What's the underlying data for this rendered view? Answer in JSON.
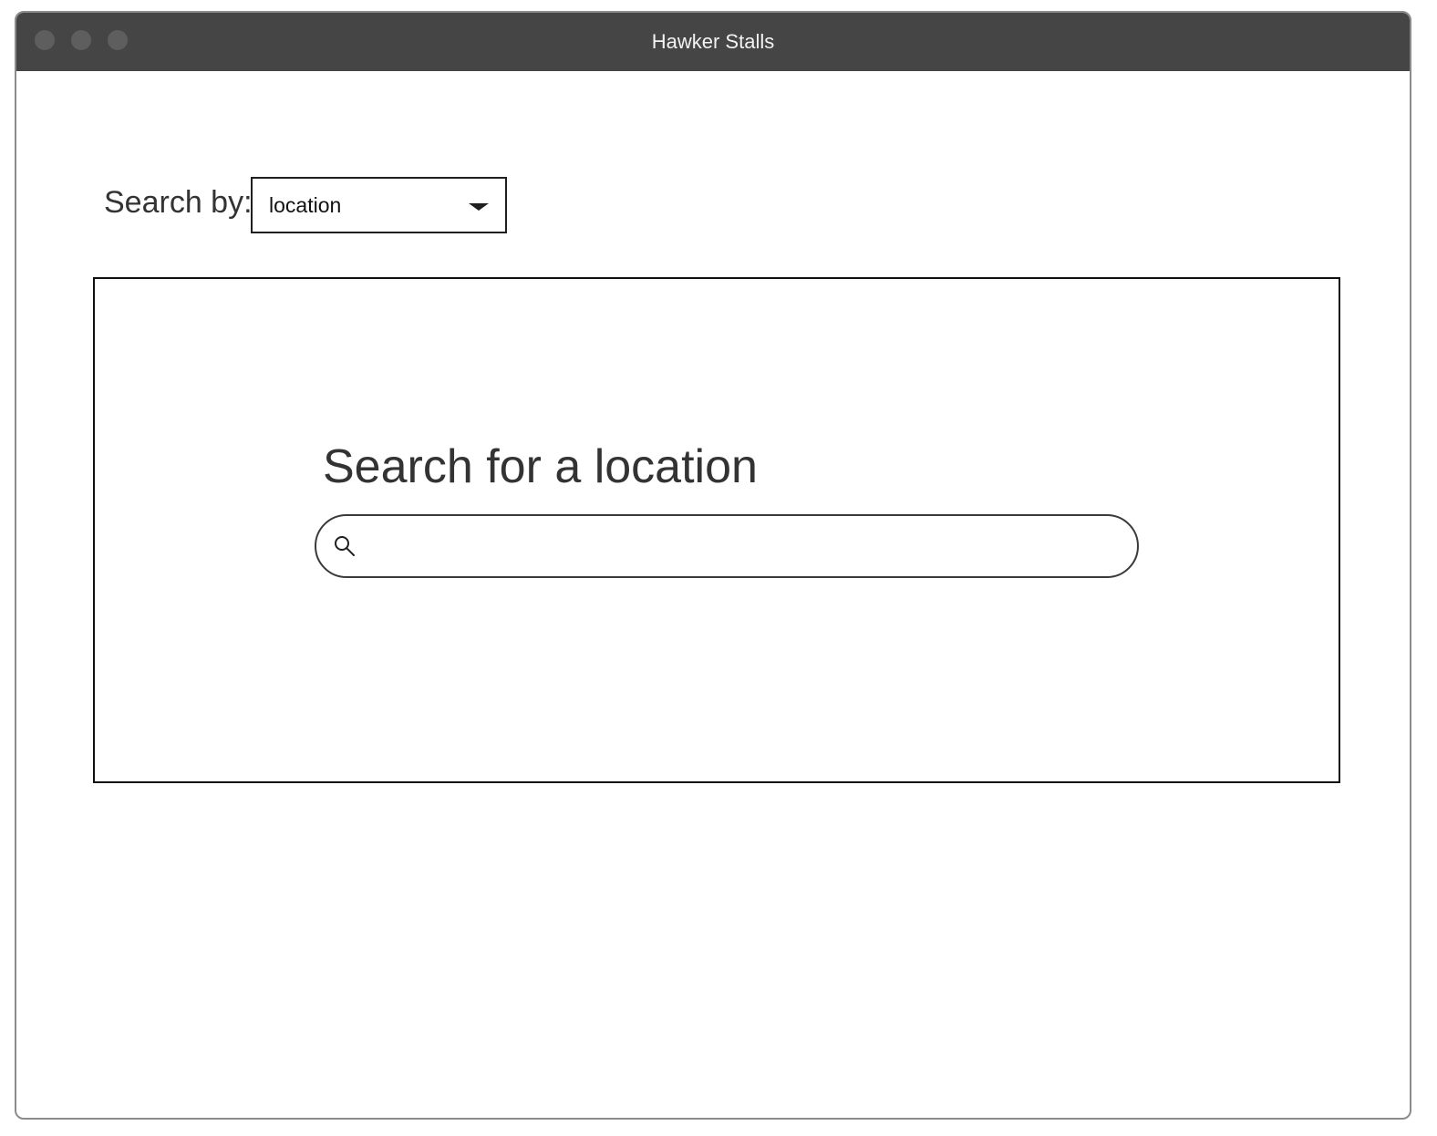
{
  "window": {
    "title": "Hawker Stalls"
  },
  "search_by": {
    "label": "Search by:",
    "selected": "location"
  },
  "panel": {
    "heading": "Search for a location",
    "search_placeholder": "",
    "search_value": ""
  },
  "icons": {
    "search": "search-icon",
    "dropdown": "chevron-down-icon"
  },
  "colors": {
    "titlebar": "#454545",
    "title_text": "#f2f2f2",
    "text": "#333333",
    "border": "#111111"
  }
}
